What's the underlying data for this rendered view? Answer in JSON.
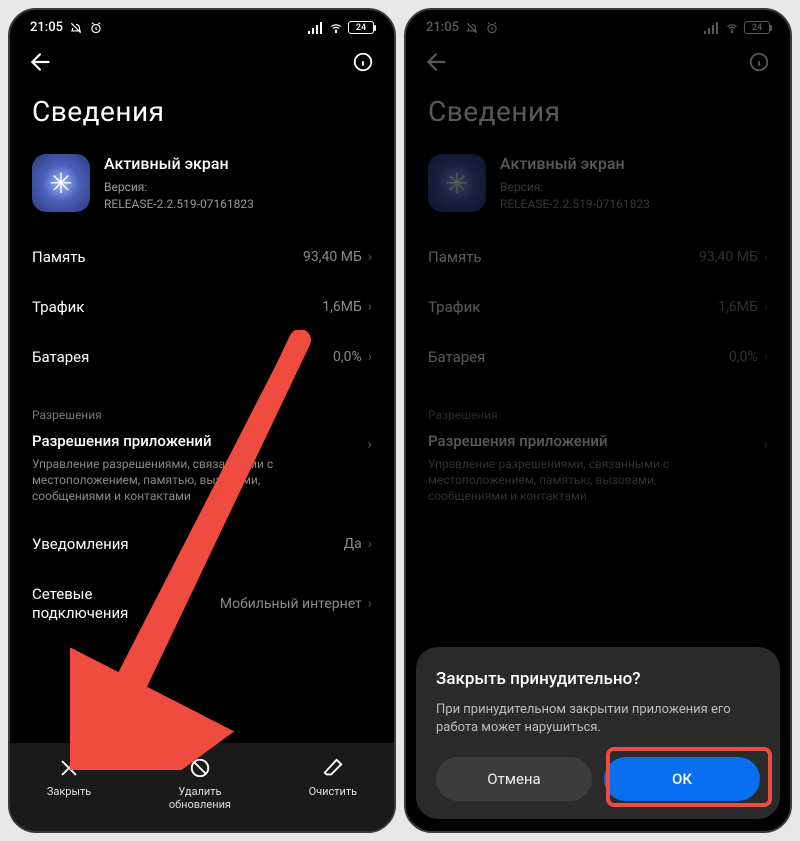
{
  "status": {
    "time": "21:05",
    "battery": "24"
  },
  "page_title": "Сведения",
  "app": {
    "name": "Активный экран",
    "version_label": "Версия:",
    "version": "RELEASE-2.2.519-07161823"
  },
  "rows": {
    "memory": {
      "label": "Память",
      "value": "93,40 МБ"
    },
    "traffic": {
      "label": "Трафик",
      "value": "1,6МБ"
    },
    "battery": {
      "label": "Батарея",
      "value": "0,0%"
    }
  },
  "perm_section": "Разрешения",
  "perm_title": "Разрешения приложений",
  "perm_desc": "Управление разрешениями, связанными с местоположением, памятью, вызовами, сообщениями и контактами",
  "notif": {
    "label": "Уведомления",
    "value": "Да"
  },
  "net": {
    "label": "Сетевые подключения",
    "value": "Мобильный интернет"
  },
  "bottom": {
    "close": "Закрыть",
    "uninstall": "Удалить обновления",
    "clear": "Очистить"
  },
  "dialog": {
    "title": "Закрыть принудительно?",
    "message": "При принудительном закрытии приложения его работа может нарушиться.",
    "cancel": "Отмена",
    "ok": "ОК"
  }
}
